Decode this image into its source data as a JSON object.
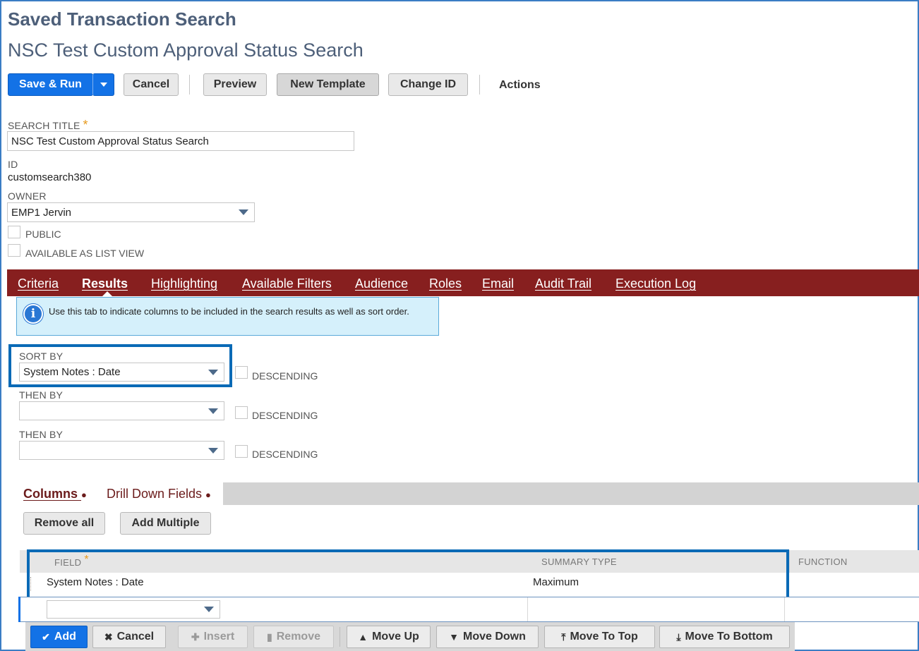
{
  "header": {
    "title": "Saved Transaction Search",
    "subtitle": "NSC Test Custom Approval Status Search"
  },
  "toolbar": {
    "save_run": "Save & Run",
    "cancel": "Cancel",
    "preview": "Preview",
    "new_template": "New Template",
    "change_id": "Change ID",
    "actions": "Actions"
  },
  "form": {
    "search_title_label": "SEARCH TITLE",
    "required_mark": "*",
    "search_title_value": "NSC Test Custom Approval Status Search",
    "id_label": "ID",
    "id_value": "customsearch380",
    "owner_label": "OWNER",
    "owner_value": "EMP1 Jervin",
    "public_label": "PUBLIC",
    "list_view_label": "AVAILABLE AS LIST VIEW"
  },
  "tabs": [
    "Criteria",
    "Results",
    "Highlighting",
    "Available Filters",
    "Audience",
    "Roles",
    "Email",
    "Audit Trail",
    "Execution Log"
  ],
  "info": {
    "icon": "i",
    "text": "Use this tab to indicate columns to be included in the search results as well as sort order."
  },
  "sort": {
    "sort_by_label": "SORT BY",
    "sort_by_value": "System Notes : Date",
    "then_by_label": "THEN BY",
    "descending_label": "DESCENDING"
  },
  "subtabs": {
    "columns": "Columns",
    "drill_down": "Drill Down Fields",
    "dot": "●"
  },
  "column_buttons": {
    "remove_all": "Remove all",
    "add_multiple": "Add Multiple"
  },
  "grid": {
    "headers": {
      "field": "FIELD",
      "summary_type": "SUMMARY TYPE",
      "function": "FUNCTION"
    },
    "rows": [
      {
        "field": "System Notes : Date",
        "summary_type": "Maximum",
        "function": ""
      }
    ]
  },
  "row_actions": {
    "add": "Add",
    "cancel": "Cancel",
    "insert": "Insert",
    "remove": "Remove",
    "move_up": "Move Up",
    "move_down": "Move Down",
    "move_to_top": "Move To Top",
    "move_to_bottom": "Move To Bottom"
  },
  "colors": {
    "accent": "#1372e6",
    "tab_bar": "#871f1f",
    "title": "#4d5f79",
    "highlight_box": "#0a6ab6",
    "info_bg": "#d5f0fb"
  }
}
